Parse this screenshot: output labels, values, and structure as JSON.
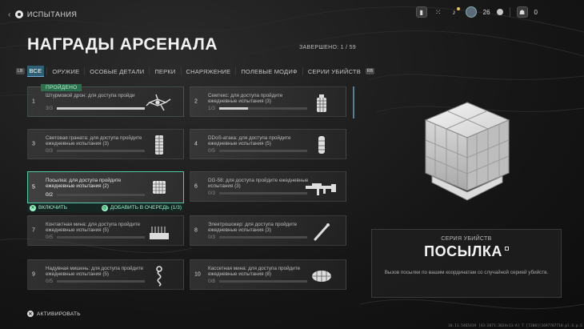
{
  "header": {
    "back_label": "ИСПЫТАНИЯ",
    "page_title": "НАГРАДЫ АРСЕНАЛА",
    "completed": "ЗАВЕРШЕНО: 1 / 59"
  },
  "top_right": {
    "level": "26",
    "players": "0"
  },
  "tabs": {
    "left_key": "LB",
    "right_key": "RB",
    "items": [
      {
        "label": "ВСЕ",
        "active": true
      },
      {
        "label": "ОРУЖИЕ",
        "active": false
      },
      {
        "label": "ОСОБЫЕ ДЕТАЛИ",
        "active": false
      },
      {
        "label": "ПЕРКИ",
        "active": false
      },
      {
        "label": "СНАРЯЖЕНИЕ",
        "active": false
      },
      {
        "label": "ПОЛЕВЫЕ МОДИФ",
        "active": false
      },
      {
        "label": "СЕРИИ УБИЙСТВ",
        "active": false
      }
    ]
  },
  "rewards": [
    {
      "num": "1",
      "title": "Штурмовой дрон: для доступа пройди",
      "progress": "3/3",
      "fraction": 1.0,
      "badge": "ПРОЙДЕНО",
      "icon": "drone-icon"
    },
    {
      "num": "2",
      "title": "Семтекс: для доступа пройдите ежедневные испытания (3)",
      "progress": "1/3",
      "fraction": 0.33,
      "icon": "semtex-icon"
    },
    {
      "num": "3",
      "title": "Световая граната: для доступа пройдите ежедневные испытания (3)",
      "progress": "0/3",
      "fraction": 0,
      "icon": "flash-grenade-icon"
    },
    {
      "num": "4",
      "title": "DDoS-атака: для доступа пройдите ежедневные испытания (5)",
      "progress": "0/5",
      "fraction": 0,
      "icon": "ddos-icon"
    },
    {
      "num": "5",
      "title": "Посылка: для доступа пройдите ежедневные испытания (2)",
      "progress": "0/2",
      "fraction": 0,
      "selected": true,
      "icon": "care-package-icon"
    },
    {
      "num": "6",
      "title": "DG-58: для доступа пройдите ежедневные испытания (3)",
      "progress": "0/3",
      "fraction": 0,
      "icon": "rifle-icon"
    },
    {
      "num": "7",
      "title": "Контактная мина: для доступа пройдите ежедневные испытания (5)",
      "progress": "0/5",
      "fraction": 0,
      "icon": "mine-icon"
    },
    {
      "num": "8",
      "title": "Электрошокер: для доступа пройдите ежедневные испытания (3)",
      "progress": "0/3",
      "fraction": 0,
      "icon": "taser-icon"
    },
    {
      "num": "9",
      "title": "Надувная мишень: для доступа пройдите ежедневные испытания (5)",
      "progress": "0/5",
      "fraction": 0,
      "icon": "decoy-icon"
    },
    {
      "num": "10",
      "title": "Кассетная мина: для доступа пройдите ежедневные испытания (8)",
      "progress": "0/8",
      "fraction": 0,
      "icon": "cluster-mine-icon"
    }
  ],
  "actions": {
    "enable": "ВКЛЮЧИТЬ",
    "queue": "ДОБАВИТЬ В ОЧЕРЕДЬ (1/3)"
  },
  "detail": {
    "type": "СЕРИЯ УБИЙСТВ",
    "name": "ПОСЫЛКА",
    "description": "Вызов посылки по вашим координатам со случайной серией убийств."
  },
  "footer": {
    "activate": "АКТИВИРОВАТЬ",
    "build": "10.11.5465419 [43:2071:3024+11:A] Т [7200][1697707718.pl.G.p.S"
  },
  "colors": {
    "accent": "#4fc9a6",
    "tab_active": "#2f5f72",
    "passed": "#2c6e4e"
  }
}
